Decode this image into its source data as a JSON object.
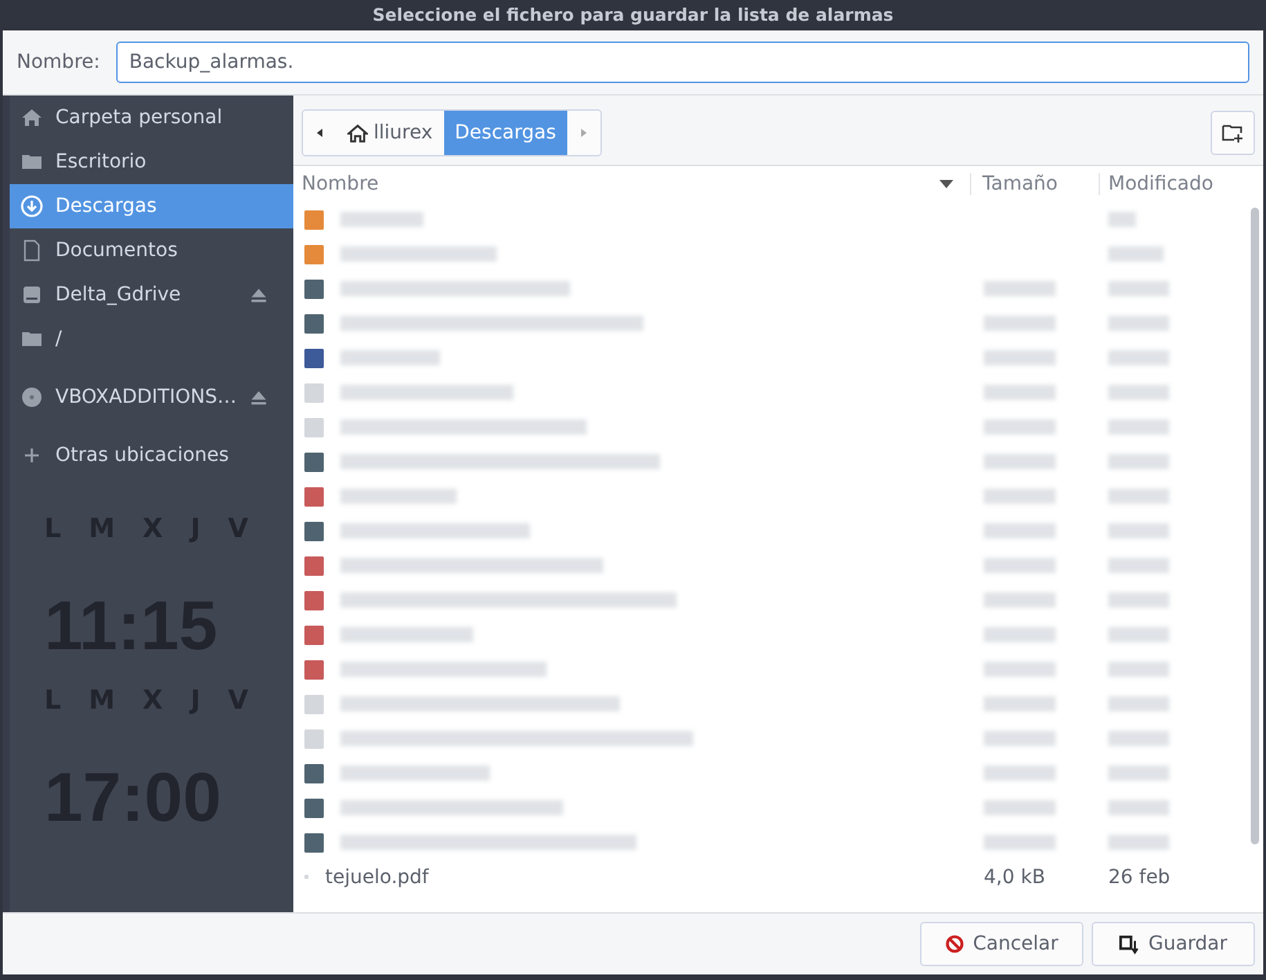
{
  "window": {
    "title": "Seleccione el fichero para guardar la lista de alarmas"
  },
  "name_field": {
    "label": "Nombre:",
    "value": "Backup_alarmas."
  },
  "sidebar": {
    "items": [
      {
        "label": "Carpeta personal",
        "kind": "home",
        "selected": false,
        "eject": false
      },
      {
        "label": "Escritorio",
        "kind": "folder",
        "selected": false,
        "eject": false
      },
      {
        "label": "Descargas",
        "kind": "download",
        "selected": true,
        "eject": false
      },
      {
        "label": "Documentos",
        "kind": "document",
        "selected": false,
        "eject": false
      },
      {
        "label": "Delta_Gdrive",
        "kind": "drive",
        "selected": false,
        "eject": true
      },
      {
        "label": "/",
        "kind": "folder",
        "selected": false,
        "eject": false
      },
      {
        "label": "VBOXADDITIONS…",
        "kind": "disc",
        "selected": false,
        "eject": true
      },
      {
        "label": "Otras ubicaciones",
        "kind": "add",
        "selected": false,
        "eject": false
      }
    ]
  },
  "background_clock": [
    {
      "kind": "days",
      "days": [
        "L",
        "M",
        "X",
        "J",
        "V"
      ]
    },
    {
      "kind": "time",
      "text": "11:15"
    },
    {
      "kind": "days",
      "days": [
        "L",
        "M",
        "X",
        "J",
        "V"
      ]
    },
    {
      "kind": "time",
      "text": "17:00"
    }
  ],
  "path_bar": {
    "crumbs": [
      {
        "label": "lliurex",
        "home": true,
        "selected": false
      },
      {
        "label": "Descargas",
        "home": false,
        "selected": true
      }
    ]
  },
  "table": {
    "columns": [
      "Nombre",
      "Tamaño",
      "Modificado"
    ],
    "rows": [
      {
        "kind": "folder",
        "blurred": true
      },
      {
        "kind": "folder",
        "blurred": true
      },
      {
        "kind": "archive",
        "blurred": true
      },
      {
        "kind": "archive",
        "blurred": true
      },
      {
        "kind": "document",
        "blurred": true
      },
      {
        "kind": "text",
        "blurred": true
      },
      {
        "kind": "text",
        "blurred": true
      },
      {
        "kind": "archive",
        "blurred": true
      },
      {
        "kind": "pdf",
        "blurred": true
      },
      {
        "kind": "archive",
        "blurred": true
      },
      {
        "kind": "pdf",
        "blurred": true
      },
      {
        "kind": "pdf",
        "blurred": true
      },
      {
        "kind": "pdf",
        "blurred": true
      },
      {
        "kind": "pdf",
        "blurred": true
      },
      {
        "kind": "text",
        "blurred": true
      },
      {
        "kind": "text",
        "blurred": true
      },
      {
        "kind": "archive",
        "blurred": true
      },
      {
        "kind": "archive",
        "blurred": true
      },
      {
        "kind": "archive",
        "blurred": true
      },
      {
        "kind": "plain",
        "blurred": false,
        "name": "tejuelo.pdf",
        "size": "4,0 kB",
        "modified": "26 feb"
      }
    ]
  },
  "buttons": [
    {
      "label": "Cancelar",
      "kind": "cancel"
    },
    {
      "label": "Guardar",
      "kind": "save"
    }
  ]
}
